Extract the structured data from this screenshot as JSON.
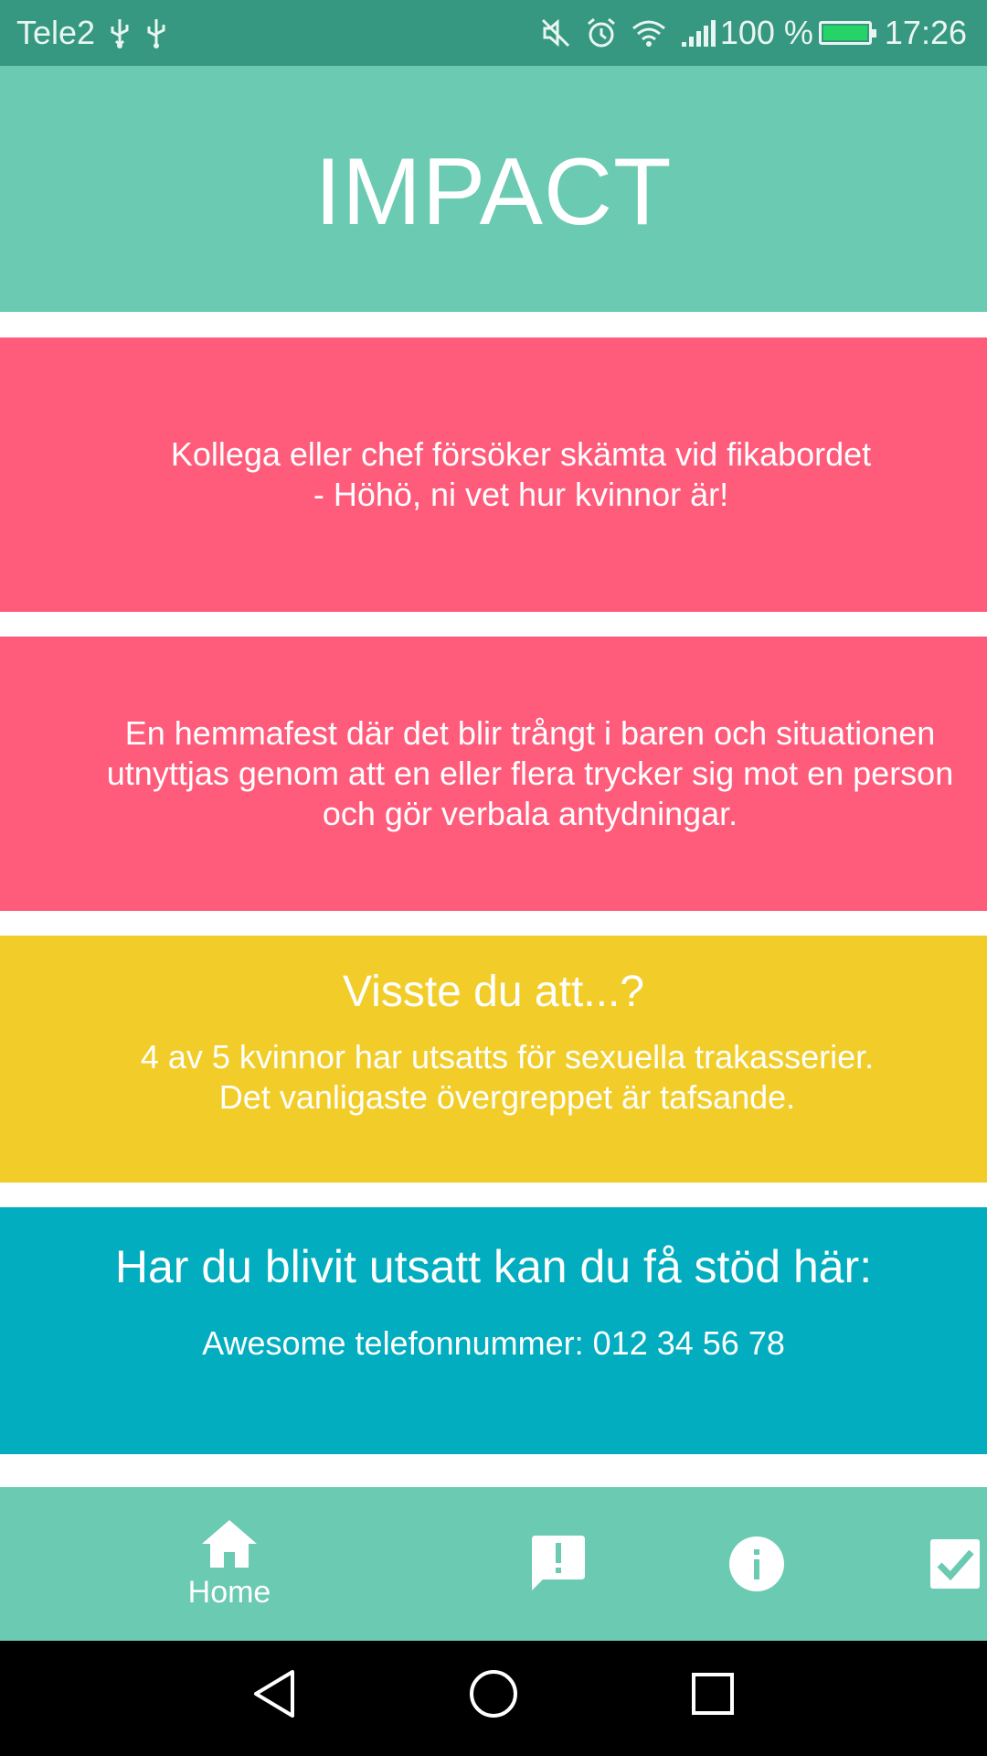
{
  "status_bar": {
    "carrier": "Tele2",
    "battery_percent": "100 %",
    "battery_level": 1.0,
    "time": "17:26",
    "icons": [
      "usb-icon",
      "usb-icon",
      "mute-icon",
      "alarm-icon",
      "wifi-icon",
      "signal-icon",
      "battery-charging-icon"
    ]
  },
  "header": {
    "title": "IMPACT"
  },
  "scenarios": [
    {
      "lines": [
        "Kollega eller chef försöker skämta vid fikabordet",
        "- Höhö, ni vet hur kvinnor är!"
      ]
    },
    {
      "lines": [
        "En hemmafest där det blir trångt i baren och situationen",
        "utnyttjas genom att en eller flera trycker sig mot en person",
        "och gör verbala antydningar."
      ]
    }
  ],
  "fact": {
    "title": "Visste du att...?",
    "lines": [
      "4 av 5 kvinnor har utsatts för sexuella trakasserier.",
      "Det vanligaste övergreppet är tafsande."
    ]
  },
  "support": {
    "title": "Har du blivit utsatt kan du få stöd här:",
    "phone": "Awesome telefonnummer: 012 34 56 78"
  },
  "bottom_nav": {
    "items": [
      {
        "label": "Home",
        "icon": "home-icon",
        "active": true
      },
      {
        "label": "",
        "icon": "report-icon"
      },
      {
        "label": "",
        "icon": "info-icon"
      },
      {
        "label": "",
        "icon": "checkbox-icon"
      }
    ]
  },
  "colors": {
    "status_bar": "#369880",
    "header": "#6acab2",
    "scenario_card": "#ff5b7b",
    "fact_card": "#f2cd2a",
    "support_card": "#02adbf",
    "bottom_nav": "#6acab2"
  }
}
